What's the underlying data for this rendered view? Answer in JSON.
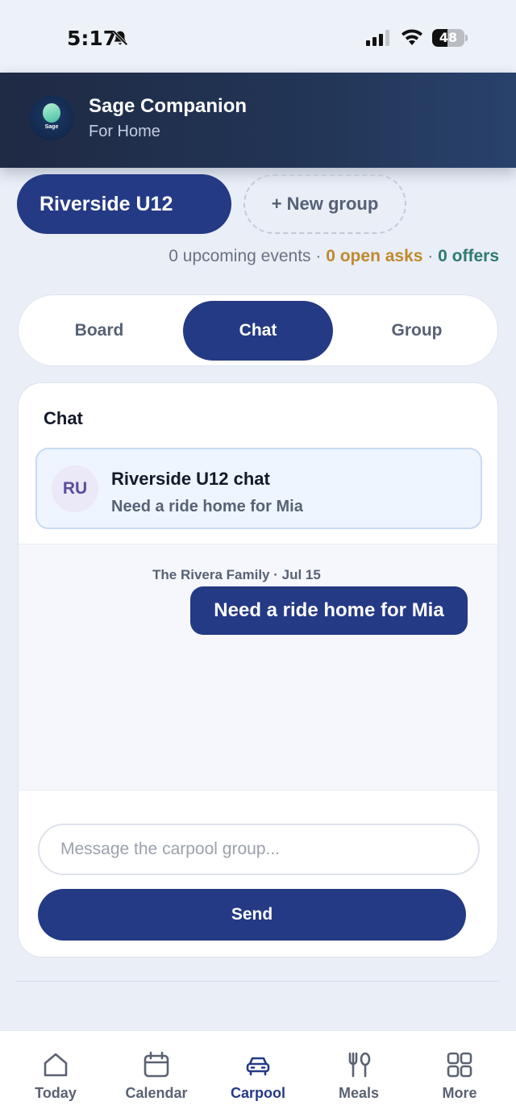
{
  "status_bar": {
    "time": "5:17",
    "battery_percent": 48,
    "icons": [
      "bell-slash-icon",
      "cellular-signal-icon",
      "wifi-icon",
      "battery-icon"
    ]
  },
  "header": {
    "logo_text": "Sage",
    "title": "Sage Companion",
    "subtitle": "For Home"
  },
  "groups": {
    "active_group": "Riverside U12",
    "new_group_label": "+ New group"
  },
  "summary": {
    "events": "0 upcoming events",
    "separator": "·",
    "asks": "0 open asks",
    "offers": "0 offers"
  },
  "tabs": [
    {
      "label": "Board",
      "active": false
    },
    {
      "label": "Chat",
      "active": true
    },
    {
      "label": "Group",
      "active": false
    }
  ],
  "chat": {
    "heading": "Chat",
    "thread": {
      "avatar_initials": "RU",
      "title": "Riverside U12 chat",
      "preview": "Need a ride home for Mia"
    },
    "messages": [
      {
        "meta": "The Rivera Family · Jul 15",
        "text": "Need a ride home for Mia"
      }
    ],
    "input": {
      "value": "",
      "placeholder": "Message the carpool group..."
    },
    "send_label": "Send"
  },
  "bottom_nav": [
    {
      "label": "Today",
      "icon": "home-icon",
      "active": false
    },
    {
      "label": "Calendar",
      "icon": "calendar-icon",
      "active": false
    },
    {
      "label": "Carpool",
      "icon": "car-icon",
      "active": true
    },
    {
      "label": "Meals",
      "icon": "utensils-icon",
      "active": false
    },
    {
      "label": "More",
      "icon": "grid-icon",
      "active": false
    }
  ],
  "colors": {
    "primary": "#243a85",
    "header": "#1f2a44",
    "asks": "#c0892d",
    "offers": "#2f7a6d",
    "background": "#e9eef7"
  }
}
